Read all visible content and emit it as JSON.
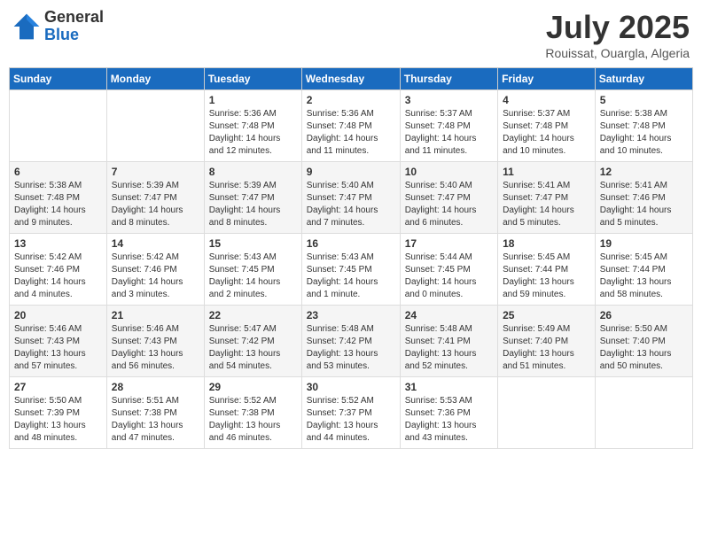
{
  "header": {
    "logo_general": "General",
    "logo_blue": "Blue",
    "month_title": "July 2025",
    "location": "Rouissat, Ouargla, Algeria"
  },
  "weekdays": [
    "Sunday",
    "Monday",
    "Tuesday",
    "Wednesday",
    "Thursday",
    "Friday",
    "Saturday"
  ],
  "weeks": [
    [
      {
        "day": "",
        "info": ""
      },
      {
        "day": "",
        "info": ""
      },
      {
        "day": "1",
        "info": "Sunrise: 5:36 AM\nSunset: 7:48 PM\nDaylight: 14 hours\nand 12 minutes."
      },
      {
        "day": "2",
        "info": "Sunrise: 5:36 AM\nSunset: 7:48 PM\nDaylight: 14 hours\nand 11 minutes."
      },
      {
        "day": "3",
        "info": "Sunrise: 5:37 AM\nSunset: 7:48 PM\nDaylight: 14 hours\nand 11 minutes."
      },
      {
        "day": "4",
        "info": "Sunrise: 5:37 AM\nSunset: 7:48 PM\nDaylight: 14 hours\nand 10 minutes."
      },
      {
        "day": "5",
        "info": "Sunrise: 5:38 AM\nSunset: 7:48 PM\nDaylight: 14 hours\nand 10 minutes."
      }
    ],
    [
      {
        "day": "6",
        "info": "Sunrise: 5:38 AM\nSunset: 7:48 PM\nDaylight: 14 hours\nand 9 minutes."
      },
      {
        "day": "7",
        "info": "Sunrise: 5:39 AM\nSunset: 7:47 PM\nDaylight: 14 hours\nand 8 minutes."
      },
      {
        "day": "8",
        "info": "Sunrise: 5:39 AM\nSunset: 7:47 PM\nDaylight: 14 hours\nand 8 minutes."
      },
      {
        "day": "9",
        "info": "Sunrise: 5:40 AM\nSunset: 7:47 PM\nDaylight: 14 hours\nand 7 minutes."
      },
      {
        "day": "10",
        "info": "Sunrise: 5:40 AM\nSunset: 7:47 PM\nDaylight: 14 hours\nand 6 minutes."
      },
      {
        "day": "11",
        "info": "Sunrise: 5:41 AM\nSunset: 7:47 PM\nDaylight: 14 hours\nand 5 minutes."
      },
      {
        "day": "12",
        "info": "Sunrise: 5:41 AM\nSunset: 7:46 PM\nDaylight: 14 hours\nand 5 minutes."
      }
    ],
    [
      {
        "day": "13",
        "info": "Sunrise: 5:42 AM\nSunset: 7:46 PM\nDaylight: 14 hours\nand 4 minutes."
      },
      {
        "day": "14",
        "info": "Sunrise: 5:42 AM\nSunset: 7:46 PM\nDaylight: 14 hours\nand 3 minutes."
      },
      {
        "day": "15",
        "info": "Sunrise: 5:43 AM\nSunset: 7:45 PM\nDaylight: 14 hours\nand 2 minutes."
      },
      {
        "day": "16",
        "info": "Sunrise: 5:43 AM\nSunset: 7:45 PM\nDaylight: 14 hours\nand 1 minute."
      },
      {
        "day": "17",
        "info": "Sunrise: 5:44 AM\nSunset: 7:45 PM\nDaylight: 14 hours\nand 0 minutes."
      },
      {
        "day": "18",
        "info": "Sunrise: 5:45 AM\nSunset: 7:44 PM\nDaylight: 13 hours\nand 59 minutes."
      },
      {
        "day": "19",
        "info": "Sunrise: 5:45 AM\nSunset: 7:44 PM\nDaylight: 13 hours\nand 58 minutes."
      }
    ],
    [
      {
        "day": "20",
        "info": "Sunrise: 5:46 AM\nSunset: 7:43 PM\nDaylight: 13 hours\nand 57 minutes."
      },
      {
        "day": "21",
        "info": "Sunrise: 5:46 AM\nSunset: 7:43 PM\nDaylight: 13 hours\nand 56 minutes."
      },
      {
        "day": "22",
        "info": "Sunrise: 5:47 AM\nSunset: 7:42 PM\nDaylight: 13 hours\nand 54 minutes."
      },
      {
        "day": "23",
        "info": "Sunrise: 5:48 AM\nSunset: 7:42 PM\nDaylight: 13 hours\nand 53 minutes."
      },
      {
        "day": "24",
        "info": "Sunrise: 5:48 AM\nSunset: 7:41 PM\nDaylight: 13 hours\nand 52 minutes."
      },
      {
        "day": "25",
        "info": "Sunrise: 5:49 AM\nSunset: 7:40 PM\nDaylight: 13 hours\nand 51 minutes."
      },
      {
        "day": "26",
        "info": "Sunrise: 5:50 AM\nSunset: 7:40 PM\nDaylight: 13 hours\nand 50 minutes."
      }
    ],
    [
      {
        "day": "27",
        "info": "Sunrise: 5:50 AM\nSunset: 7:39 PM\nDaylight: 13 hours\nand 48 minutes."
      },
      {
        "day": "28",
        "info": "Sunrise: 5:51 AM\nSunset: 7:38 PM\nDaylight: 13 hours\nand 47 minutes."
      },
      {
        "day": "29",
        "info": "Sunrise: 5:52 AM\nSunset: 7:38 PM\nDaylight: 13 hours\nand 46 minutes."
      },
      {
        "day": "30",
        "info": "Sunrise: 5:52 AM\nSunset: 7:37 PM\nDaylight: 13 hours\nand 44 minutes."
      },
      {
        "day": "31",
        "info": "Sunrise: 5:53 AM\nSunset: 7:36 PM\nDaylight: 13 hours\nand 43 minutes."
      },
      {
        "day": "",
        "info": ""
      },
      {
        "day": "",
        "info": ""
      }
    ]
  ]
}
